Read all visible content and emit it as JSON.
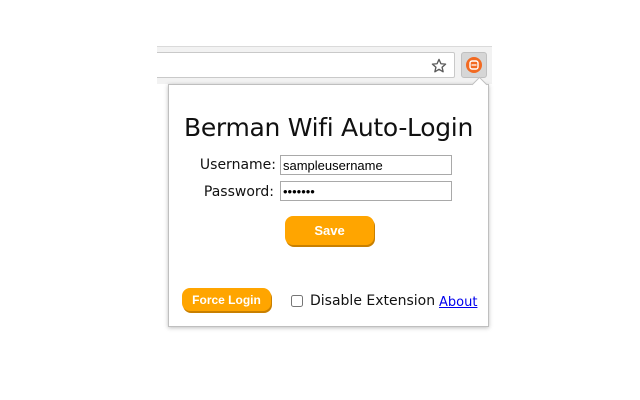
{
  "browser": {
    "bookmark_icon": "star-icon",
    "extension_icon": "berman-logo-icon",
    "extension_letter": "B",
    "accent": "#f26a21"
  },
  "popup": {
    "title": "Berman Wifi Auto-Login",
    "username_label": "Username:",
    "username_value": "sampleusername",
    "password_label": "Password:",
    "password_value": "sampleP",
    "save_label": "Save",
    "force_login_label": "Force Login",
    "disable_label": "Disable Extension",
    "disable_checked": false,
    "about_label": "About",
    "button_color": "#ffa500",
    "link_color": "#0000ee"
  }
}
